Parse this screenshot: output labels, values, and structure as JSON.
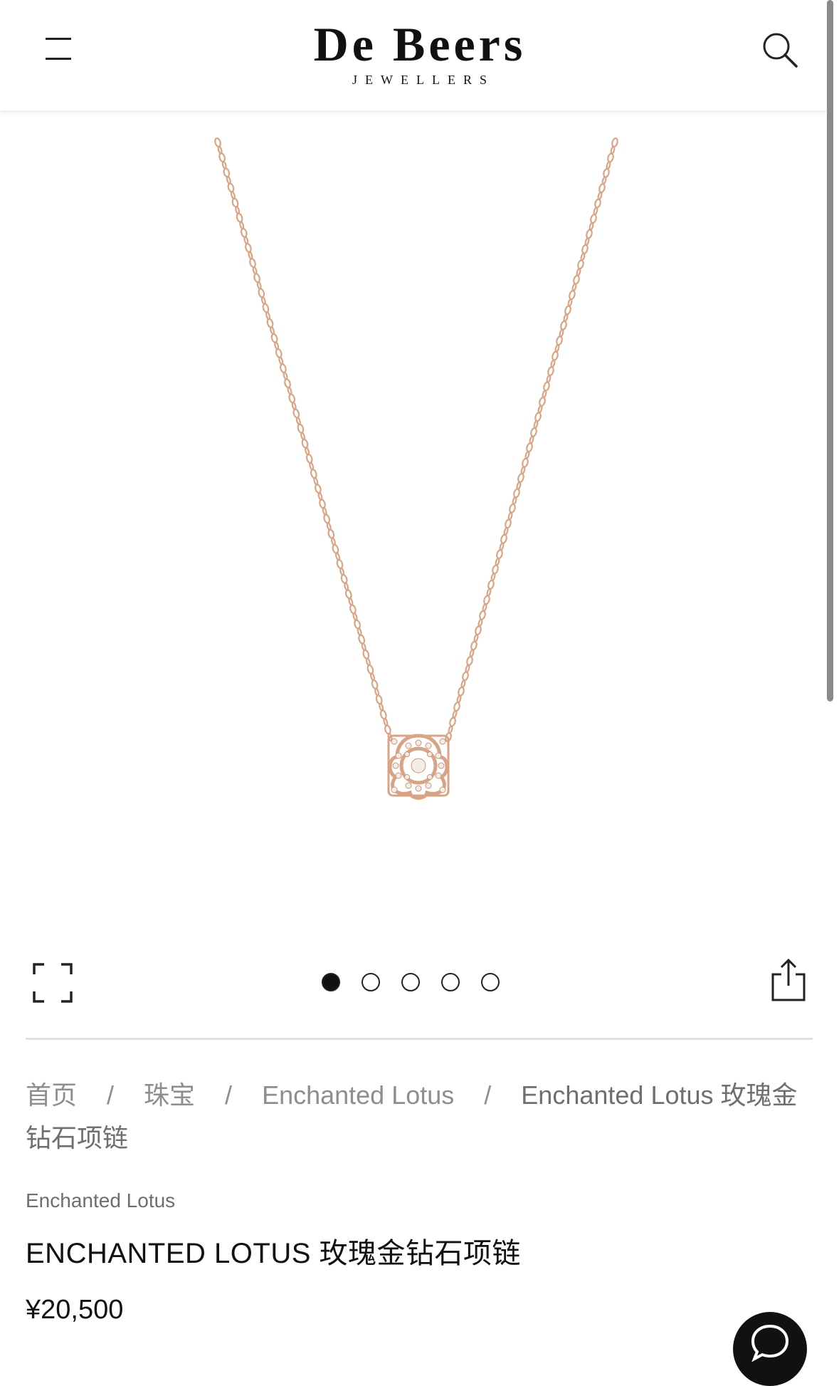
{
  "header": {
    "logo_main": "De Beers",
    "logo_sub": "JEWELLERS",
    "menu_icon": "hamburger-menu-icon",
    "search_icon": "search-icon"
  },
  "gallery": {
    "image_alt": "Enchanted Lotus rose gold diamond necklace",
    "image_count": 5,
    "active_index": 0,
    "fullscreen_icon": "expand-icon",
    "share_icon": "share-icon",
    "metal_color": "#d9a386"
  },
  "breadcrumb": {
    "items": [
      "首页",
      "珠宝",
      "Enchanted Lotus",
      "Enchanted Lotus 玫瑰金钻石项链"
    ],
    "separator": "/"
  },
  "product": {
    "collection": "Enchanted Lotus",
    "title": "ENCHANTED LOTUS 玫瑰金钻石项链",
    "price": "¥20,500"
  },
  "chat": {
    "icon": "chat-icon"
  }
}
